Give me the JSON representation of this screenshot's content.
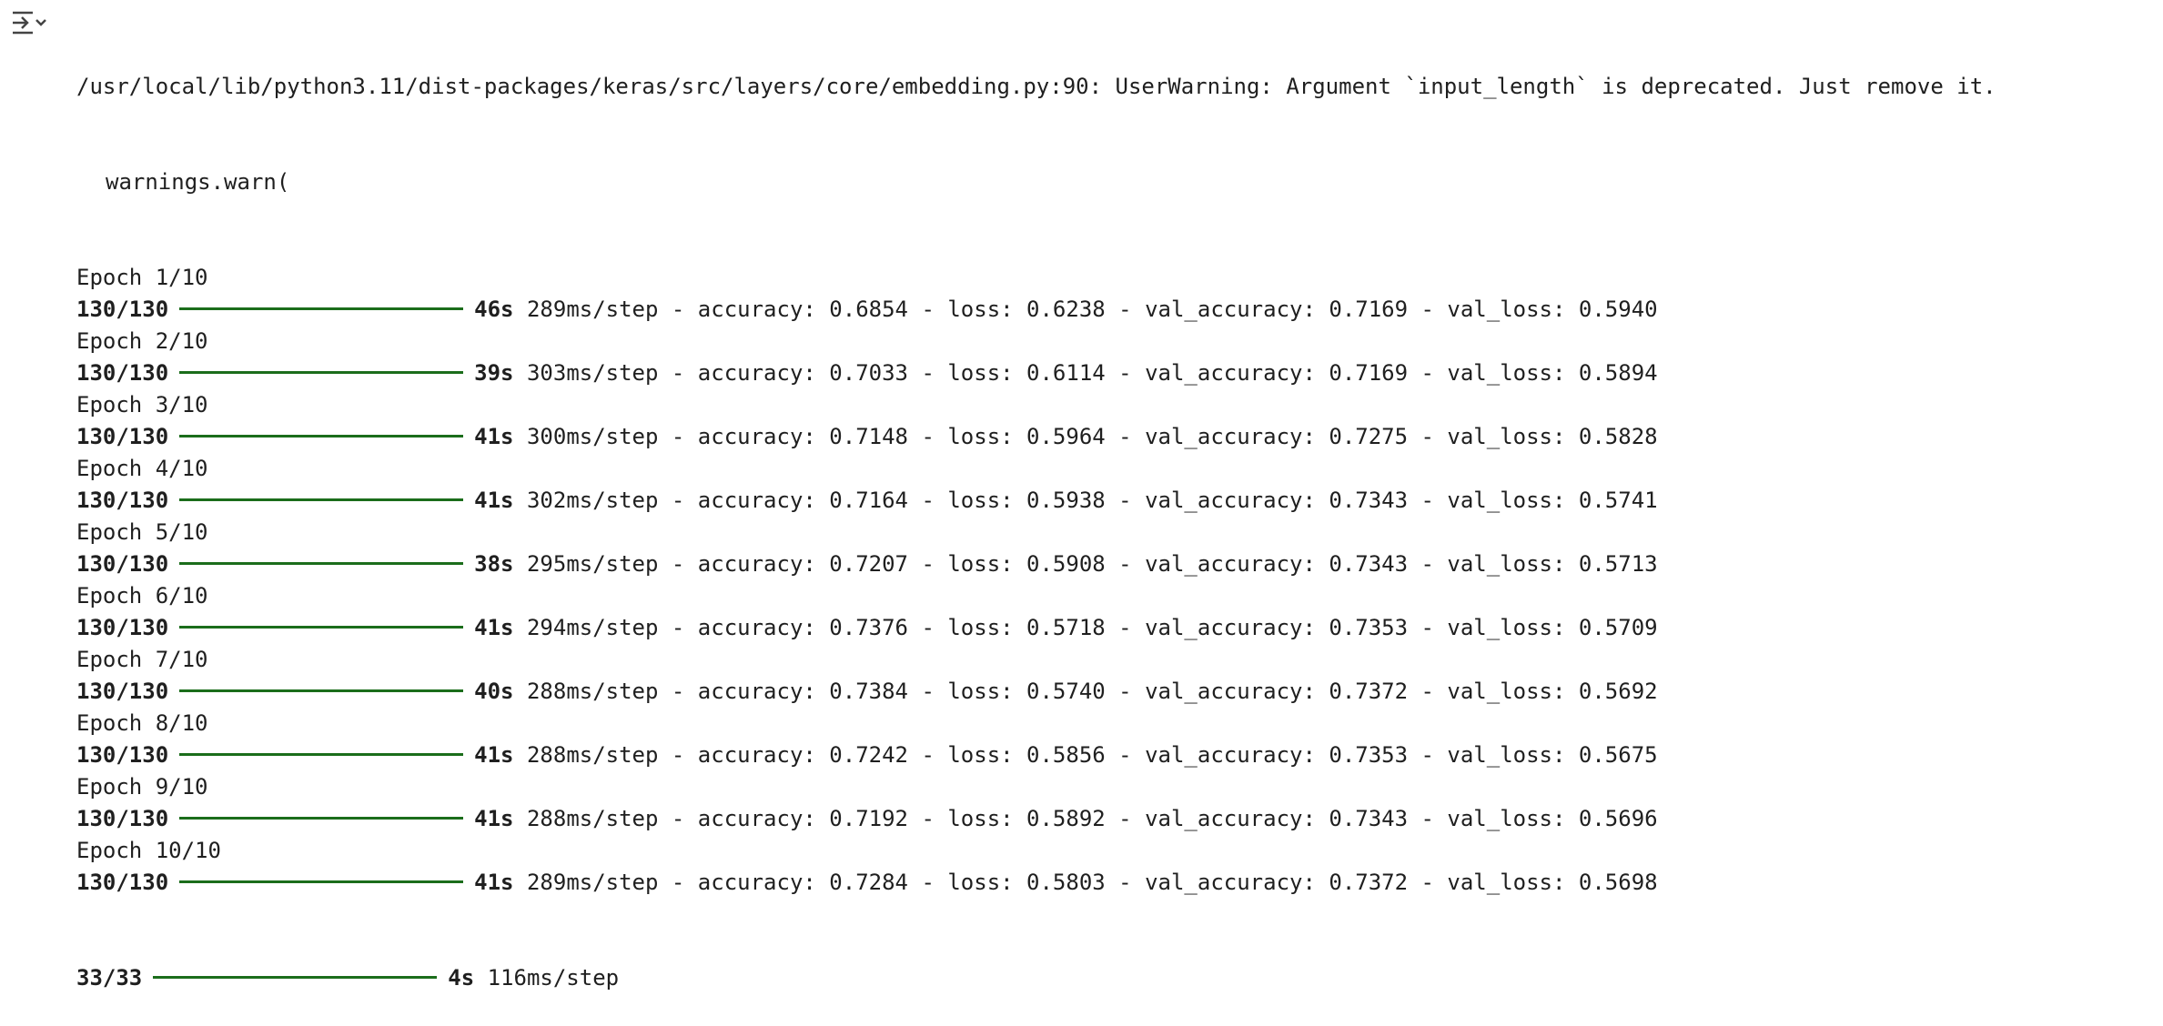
{
  "toggle_icon": "output-collapse-icon",
  "warning": {
    "line1": "/usr/local/lib/python3.11/dist-packages/keras/src/layers/core/embedding.py:90: UserWarning: Argument `input_length` is deprecated. Just remove it.",
    "line2": "warnings.warn("
  },
  "colors": {
    "bar": "#1b6d1b",
    "text": "#1f1f1f"
  },
  "epochs": [
    {
      "label": "Epoch 1/10",
      "steps": "130/130",
      "progress": 1.0,
      "time": "46s",
      "rest": " 289ms/step - accuracy: 0.6854 - loss: 0.6238 - val_accuracy: 0.7169 - val_loss: 0.5940"
    },
    {
      "label": "Epoch 2/10",
      "steps": "130/130",
      "progress": 1.0,
      "time": "39s",
      "rest": " 303ms/step - accuracy: 0.7033 - loss: 0.6114 - val_accuracy: 0.7169 - val_loss: 0.5894"
    },
    {
      "label": "Epoch 3/10",
      "steps": "130/130",
      "progress": 1.0,
      "time": "41s",
      "rest": " 300ms/step - accuracy: 0.7148 - loss: 0.5964 - val_accuracy: 0.7275 - val_loss: 0.5828"
    },
    {
      "label": "Epoch 4/10",
      "steps": "130/130",
      "progress": 1.0,
      "time": "41s",
      "rest": " 302ms/step - accuracy: 0.7164 - loss: 0.5938 - val_accuracy: 0.7343 - val_loss: 0.5741"
    },
    {
      "label": "Epoch 5/10",
      "steps": "130/130",
      "progress": 1.0,
      "time": "38s",
      "rest": " 295ms/step - accuracy: 0.7207 - loss: 0.5908 - val_accuracy: 0.7343 - val_loss: 0.5713"
    },
    {
      "label": "Epoch 6/10",
      "steps": "130/130",
      "progress": 1.0,
      "time": "41s",
      "rest": " 294ms/step - accuracy: 0.7376 - loss: 0.5718 - val_accuracy: 0.7353 - val_loss: 0.5709"
    },
    {
      "label": "Epoch 7/10",
      "steps": "130/130",
      "progress": 1.0,
      "time": "40s",
      "rest": " 288ms/step - accuracy: 0.7384 - loss: 0.5740 - val_accuracy: 0.7372 - val_loss: 0.5692"
    },
    {
      "label": "Epoch 8/10",
      "steps": "130/130",
      "progress": 1.0,
      "time": "41s",
      "rest": " 288ms/step - accuracy: 0.7242 - loss: 0.5856 - val_accuracy: 0.7353 - val_loss: 0.5675"
    },
    {
      "label": "Epoch 9/10",
      "steps": "130/130",
      "progress": 1.0,
      "time": "41s",
      "rest": " 288ms/step - accuracy: 0.7192 - loss: 0.5892 - val_accuracy: 0.7343 - val_loss: 0.5696"
    },
    {
      "label": "Epoch 10/10",
      "steps": "130/130",
      "progress": 1.0,
      "time": "41s",
      "rest": " 289ms/step - accuracy: 0.7284 - loss: 0.5803 - val_accuracy: 0.7372 - val_loss: 0.5698"
    }
  ],
  "evaluate": {
    "steps": "33/33",
    "progress": 1.0,
    "time": "4s",
    "rest": " 116ms/step"
  }
}
